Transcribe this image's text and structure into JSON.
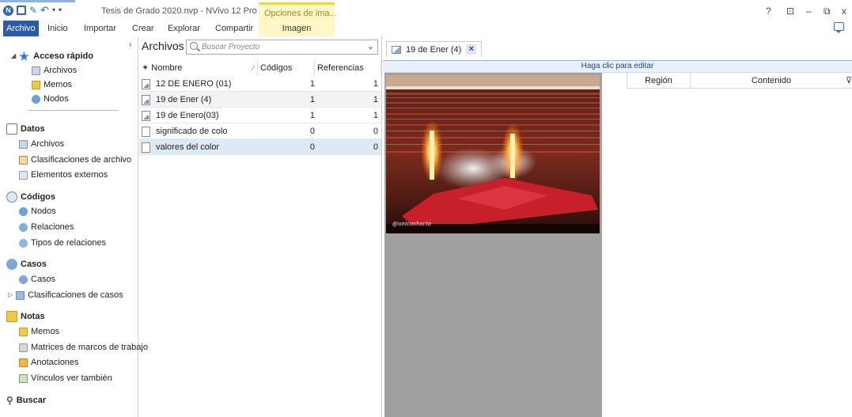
{
  "window": {
    "title": "Tesis de Grado 2020.nvp - NVivo 12 Pro",
    "context_group": "Opciones de ima...",
    "controls": [
      "?",
      "⊡",
      "–",
      "⧉",
      "x"
    ]
  },
  "ribbon": {
    "tabs": [
      "Archivo",
      "Inicio",
      "Importar",
      "Crear",
      "Explorar",
      "Compartir"
    ],
    "context_tab": "Imagen"
  },
  "nav": {
    "quick_access": {
      "label": "Acceso rápido",
      "items": [
        "Archivos",
        "Memos",
        "Nodos"
      ]
    },
    "sections": [
      {
        "label": "Datos",
        "items": [
          "Archivos",
          "Clasificaciones de archivo",
          "Elementos externos"
        ]
      },
      {
        "label": "Códigos",
        "items": [
          "Nodos",
          "Relaciones",
          "Tipos de relaciones"
        ]
      },
      {
        "label": "Casos",
        "items": [
          "Casos",
          "Clasificaciones de casos"
        ]
      },
      {
        "label": "Notas",
        "items": [
          "Memos",
          "Matrices de marcos de trabajo",
          "Anotaciones",
          "Vínculos ver también"
        ]
      }
    ],
    "search_label": "Buscar"
  },
  "list": {
    "title": "Archivos",
    "search_placeholder": "Buscar Proyecto",
    "columns": [
      "Nombre",
      "Códigos",
      "Referencias"
    ],
    "rows": [
      {
        "name": "12 DE ENERO (01)",
        "codes": "1",
        "refs": "1"
      },
      {
        "name": "19 de Ener (4)",
        "codes": "1",
        "refs": "1"
      },
      {
        "name": "19 de Enero(03)",
        "codes": "1",
        "refs": "1"
      },
      {
        "name": "significado de colo",
        "codes": "0",
        "refs": "0"
      },
      {
        "name": "valores del color",
        "codes": "0",
        "refs": "0"
      }
    ]
  },
  "detail": {
    "tab_label": "19 de Ener (4)",
    "edit_hint": "Haga clic para editar",
    "columns": [
      "Región",
      "Contenido"
    ],
    "watermark": "@unicoshacia"
  },
  "colors": {
    "accent": "#2b5cab",
    "context": "#f4d829",
    "selected_row": "#ddeaf5"
  }
}
